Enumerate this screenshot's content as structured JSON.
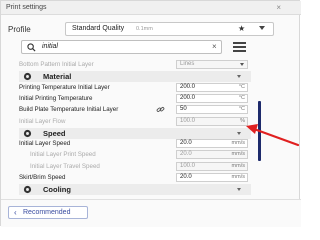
{
  "window": {
    "title": "Print settings",
    "close_glyph": "×"
  },
  "profile": {
    "label": "Profile",
    "value": "Standard Quality",
    "sub": "0.1mm",
    "star_glyph": "★"
  },
  "search": {
    "value": "initial",
    "clear_glyph": "×"
  },
  "rows": [
    {
      "label": "Bottom Pattern Initial Layer",
      "value": "Lines",
      "unit": "",
      "dim": true
    },
    {
      "category": true,
      "label": "Material"
    },
    {
      "label": "Printing Temperature Initial Layer",
      "value": "200.0",
      "unit": "°C"
    },
    {
      "label": "Initial Printing Temperature",
      "value": "200.0",
      "unit": "°C"
    },
    {
      "label": "Build Plate Temperature Initial Layer",
      "value": "50",
      "unit": "°C",
      "link": true
    },
    {
      "label": "Initial Layer Flow",
      "value": "100.0",
      "unit": "%",
      "dim": true
    },
    {
      "category": true,
      "label": "Speed"
    },
    {
      "label": "Initial Layer Speed",
      "value": "20.0",
      "unit": "mm/s"
    },
    {
      "label": "Initial Layer Print Speed",
      "value": "20.0",
      "unit": "mm/s",
      "indent": true,
      "dim": true
    },
    {
      "label": "Initial Layer Travel Speed",
      "value": "100.0",
      "unit": "mm/s",
      "indent": true,
      "dim": true
    },
    {
      "label": "Skirt/Brim Speed",
      "value": "20.0",
      "unit": "mm/s"
    },
    {
      "category": true,
      "label": "Cooling"
    }
  ],
  "footer": {
    "recommended_label": "Recommended",
    "chevron_glyph": "‹"
  },
  "colors": {
    "accent": "#3a4da0",
    "scrollbar": "#1d2a6b",
    "arrow": "#e02020"
  }
}
